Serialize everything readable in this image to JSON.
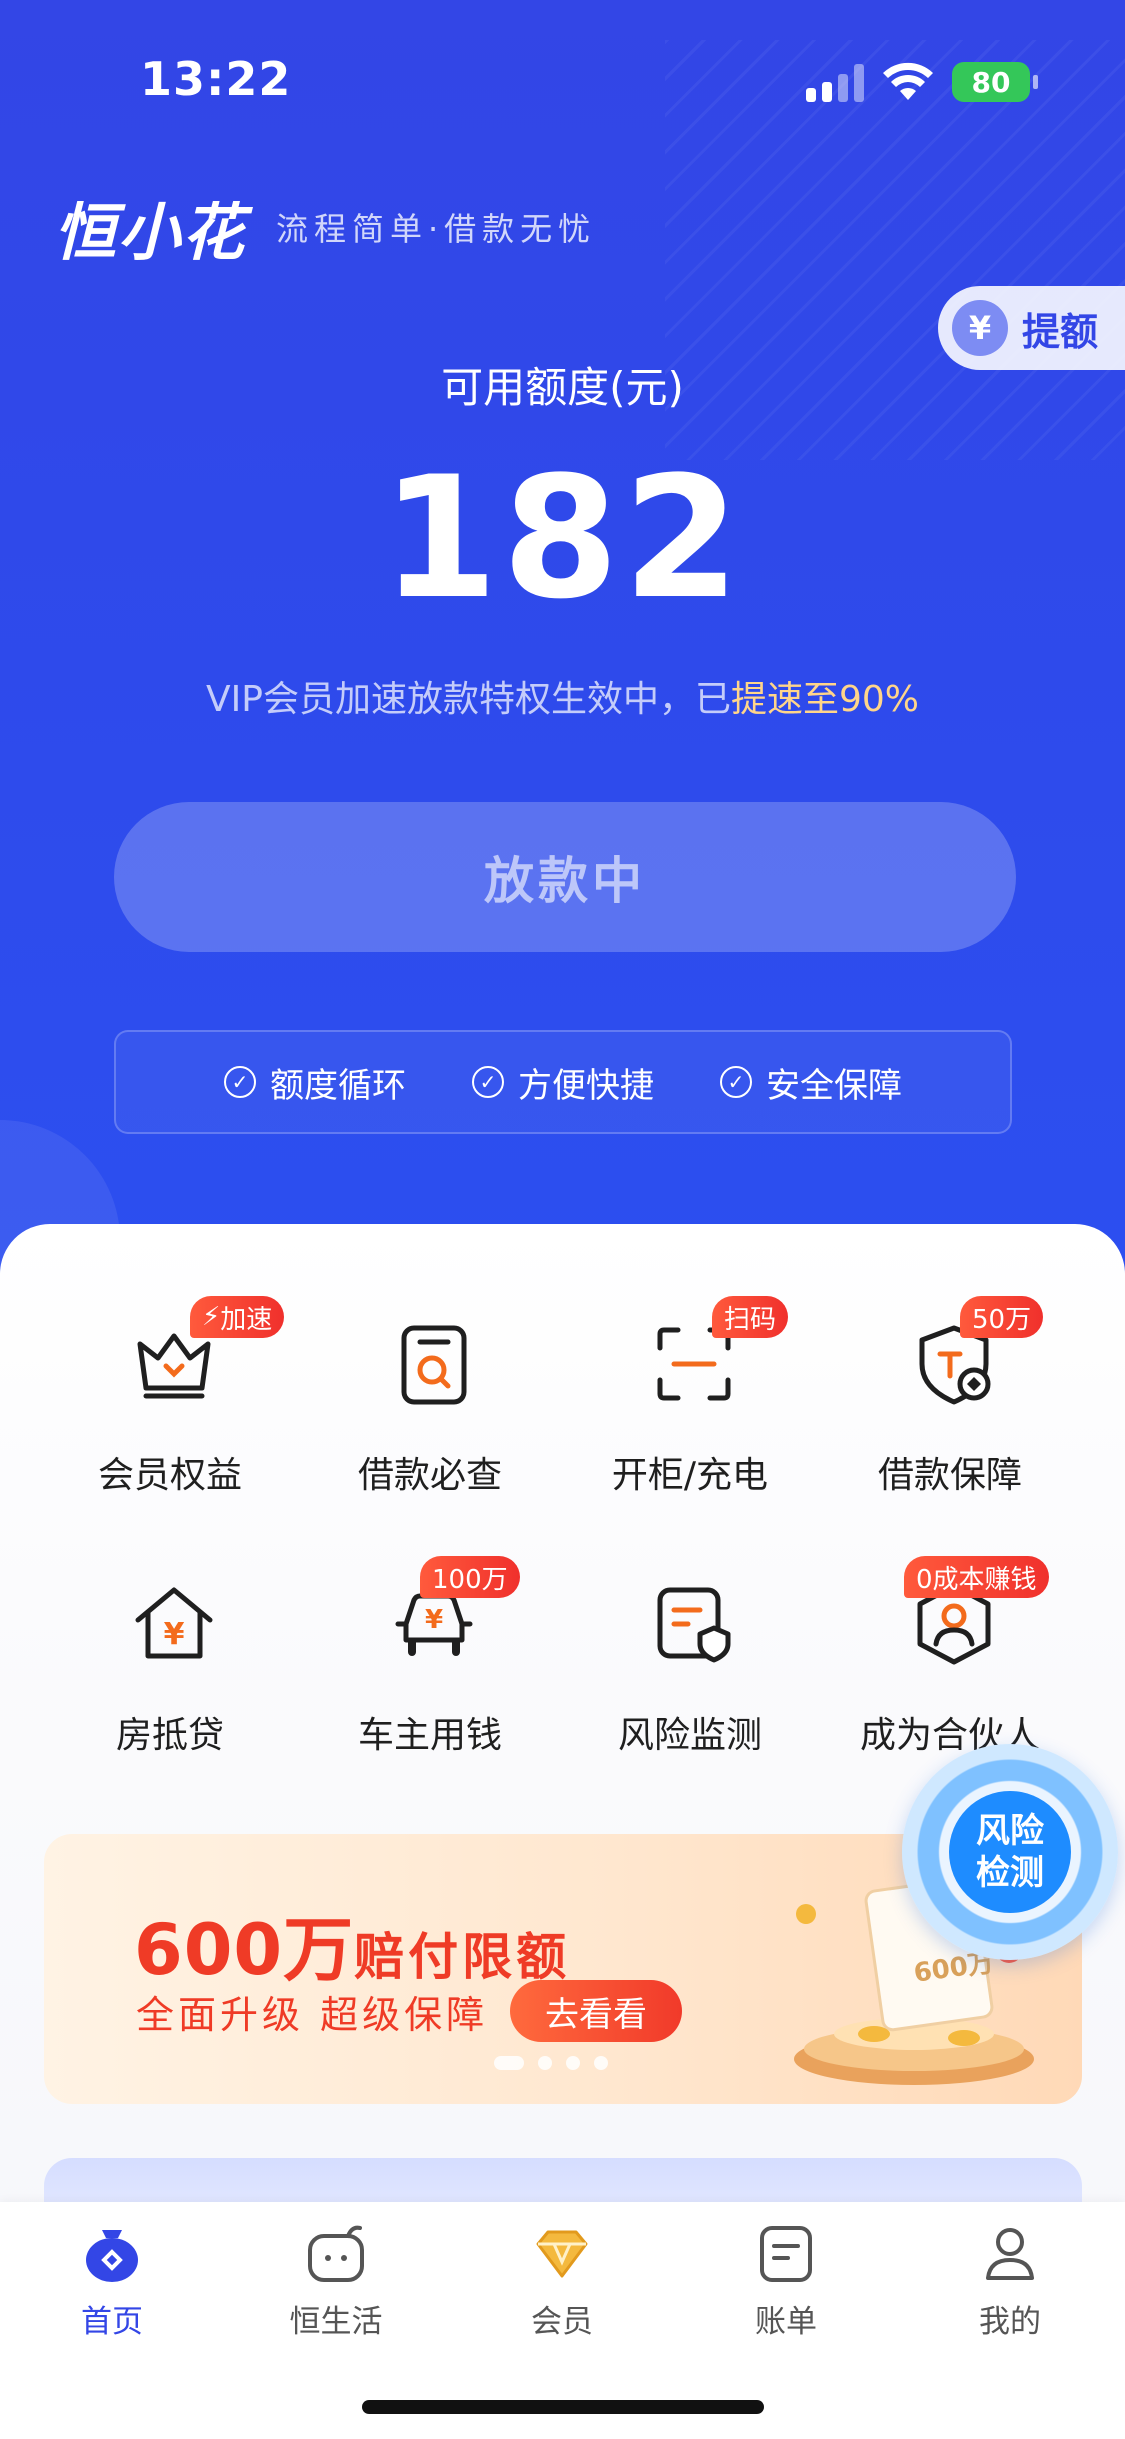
{
  "status_bar": {
    "time": "13:22",
    "battery": "80"
  },
  "brand": {
    "logo": "恒小花",
    "slogan": "流程简单·借款无忧"
  },
  "raise_button": {
    "icon": "yen-icon",
    "label": "提额"
  },
  "credit": {
    "label": "可用额度(元)",
    "amount": "182",
    "note_prefix": "VIP会员加速放款特权生效中，已",
    "note_highlight": "提速至90%"
  },
  "loan_button": {
    "label": "放款中"
  },
  "features": [
    "额度循环",
    "方便快捷",
    "安全保障"
  ],
  "services": [
    {
      "label": "会员权益",
      "icon": "crown-icon",
      "tag": "加速"
    },
    {
      "label": "借款必查",
      "icon": "search-document-icon",
      "tag": ""
    },
    {
      "label": "开柜/充电",
      "icon": "scan-icon",
      "tag": "扫码"
    },
    {
      "label": "借款保障",
      "icon": "shield-icon",
      "tag": "50万"
    },
    {
      "label": "房抵贷",
      "icon": "house-yen-icon",
      "tag": ""
    },
    {
      "label": "车主用钱",
      "icon": "car-yen-icon",
      "tag": "100万"
    },
    {
      "label": "风险监测",
      "icon": "risk-monitor-icon",
      "tag": ""
    },
    {
      "label": "成为合伙人",
      "icon": "partner-icon",
      "tag": "0成本赚钱"
    }
  ],
  "risk_badge": {
    "line1": "风险",
    "line2": "检测"
  },
  "banner": {
    "title_number": "600万",
    "title_text": "赔付限额",
    "subtitle": "全面升级 超级保障",
    "cta": "去看看",
    "art_label": "600万",
    "slides": 4,
    "active_slide": 1
  },
  "tabs": [
    {
      "label": "首页",
      "icon": "home-icon",
      "active": true
    },
    {
      "label": "恒生活",
      "icon": "life-icon",
      "active": false
    },
    {
      "label": "会员",
      "icon": "diamond-icon",
      "active": false
    },
    {
      "label": "账单",
      "icon": "bill-icon",
      "active": false
    },
    {
      "label": "我的",
      "icon": "profile-icon",
      "active": false
    }
  ],
  "colors": {
    "primary_blue": "#3346e6",
    "accent_red": "#ef3b26",
    "highlight_gold": "#ffd58a",
    "battery_green": "#34c759"
  }
}
